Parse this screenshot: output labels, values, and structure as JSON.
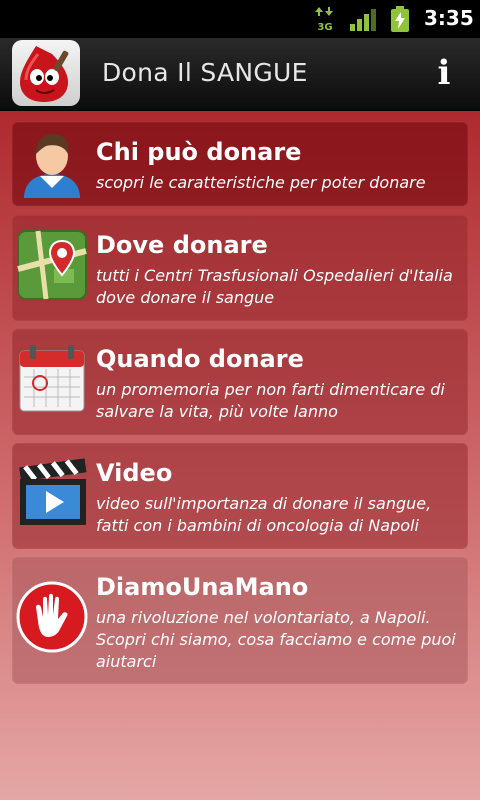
{
  "status_bar": {
    "time": "3:35",
    "network_label": "3G",
    "icons": [
      "data-3g-icon",
      "signal-icon",
      "battery-charging-icon"
    ]
  },
  "header": {
    "title": "Dona Il SANGUE",
    "info_label": "i",
    "icons": [
      "blood-drop-logo-icon",
      "info-icon"
    ]
  },
  "menu": {
    "items": [
      {
        "title": "Chi può donare",
        "description": "scopri le caratteristiche per poter donare",
        "icon": "person-icon"
      },
      {
        "title": "Dove donare",
        "description": "tutti i Centri Trasfusionali Ospedalieri d'Italia dove donare il sangue",
        "icon": "map-pin-icon"
      },
      {
        "title": "Quando donare",
        "description": "un promemoria per non farti dimenticare di salvare la vita, più volte lanno",
        "icon": "calendar-icon"
      },
      {
        "title": "Video",
        "description": "video sull'importanza di donare il sangue, fatti con i bambini di oncologia di Napoli",
        "icon": "video-clapper-icon"
      },
      {
        "title": "DiamoUnaMano",
        "description": "una rivoluzione nel volontariato, a Napoli. Scopri chi siamo, cosa facciamo e come puoi aiutarci",
        "icon": "hand-icon"
      }
    ]
  },
  "colors": {
    "status_bar": "#000000",
    "title_bar": "#1a1a1a",
    "accent_red": "#c8141b",
    "background_top": "#a5151b",
    "background_bottom": "#e4a7a5"
  }
}
